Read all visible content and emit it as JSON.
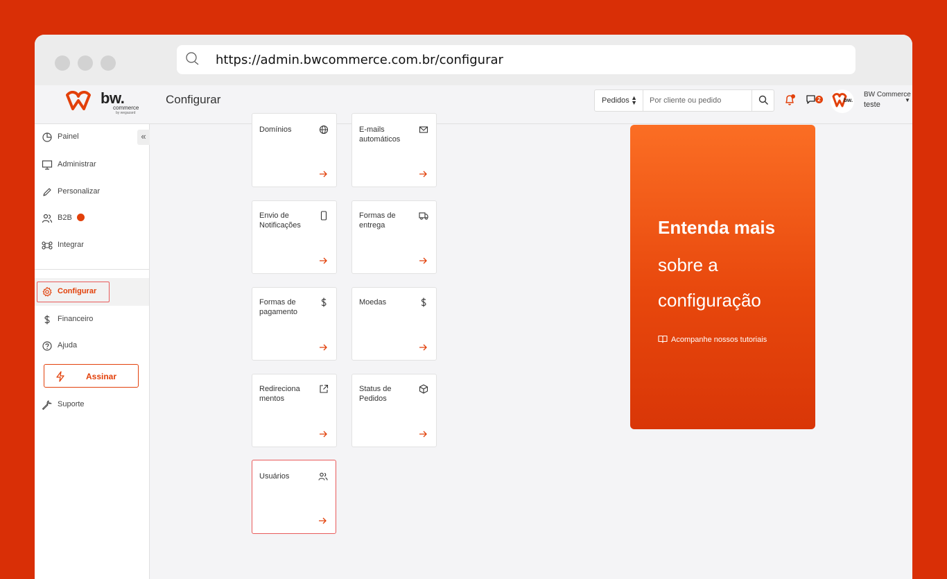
{
  "browser": {
    "url": "https://admin.bwcommerce.com.br/configurar"
  },
  "header": {
    "logo": {
      "brand": "bw.",
      "sub": "commerce",
      "by": "by wegazard"
    },
    "page_title": "Configurar",
    "search": {
      "filter_value": "Pedidos",
      "placeholder": "Por cliente ou pedido"
    },
    "chat_badge": "2",
    "store": {
      "name": "BW Commerce",
      "sub": "teste"
    }
  },
  "sidebar": {
    "items": [
      {
        "label": "Painel",
        "icon": "clock-icon"
      },
      {
        "label": "Administrar",
        "icon": "monitor-icon"
      },
      {
        "label": "Personalizar",
        "icon": "pencil-icon"
      },
      {
        "label": "B2B",
        "icon": "users-icon"
      },
      {
        "label": "Integrar",
        "icon": "command-icon"
      },
      {
        "label": "Configurar",
        "icon": "settings-icon"
      },
      {
        "label": "Financeiro",
        "icon": "dollar-icon"
      },
      {
        "label": "Ajuda",
        "icon": "help-icon"
      },
      {
        "label": "Suporte",
        "icon": "wrench-icon"
      }
    ],
    "active": "Configurar",
    "assinar_label": "Assinar"
  },
  "cards": [
    {
      "title": "Domínios",
      "icon": "globe-icon"
    },
    {
      "title": "E-mails automáticos",
      "icon": "mail-icon"
    },
    {
      "title": "Envio de Notificações",
      "icon": "phone-icon"
    },
    {
      "title": "Formas de entrega",
      "icon": "truck-icon"
    },
    {
      "title": "Formas de pagamento",
      "icon": "dollar-icon"
    },
    {
      "title": "Moedas",
      "icon": "dollar-icon"
    },
    {
      "title": "Redireciona mentos",
      "icon": "external-link-icon"
    },
    {
      "title": "Status de Pedidos",
      "icon": "box-icon"
    },
    {
      "title": "Usuários",
      "icon": "users-icon"
    }
  ],
  "promo": {
    "line1": "Entenda mais",
    "line2": "sobre a",
    "line3": "configuração",
    "link": "Acompanhe nossos tutoriais"
  },
  "colors": {
    "background": "#d92f06",
    "accent": "#e2400a",
    "highlight_border": "#e85a5a"
  }
}
